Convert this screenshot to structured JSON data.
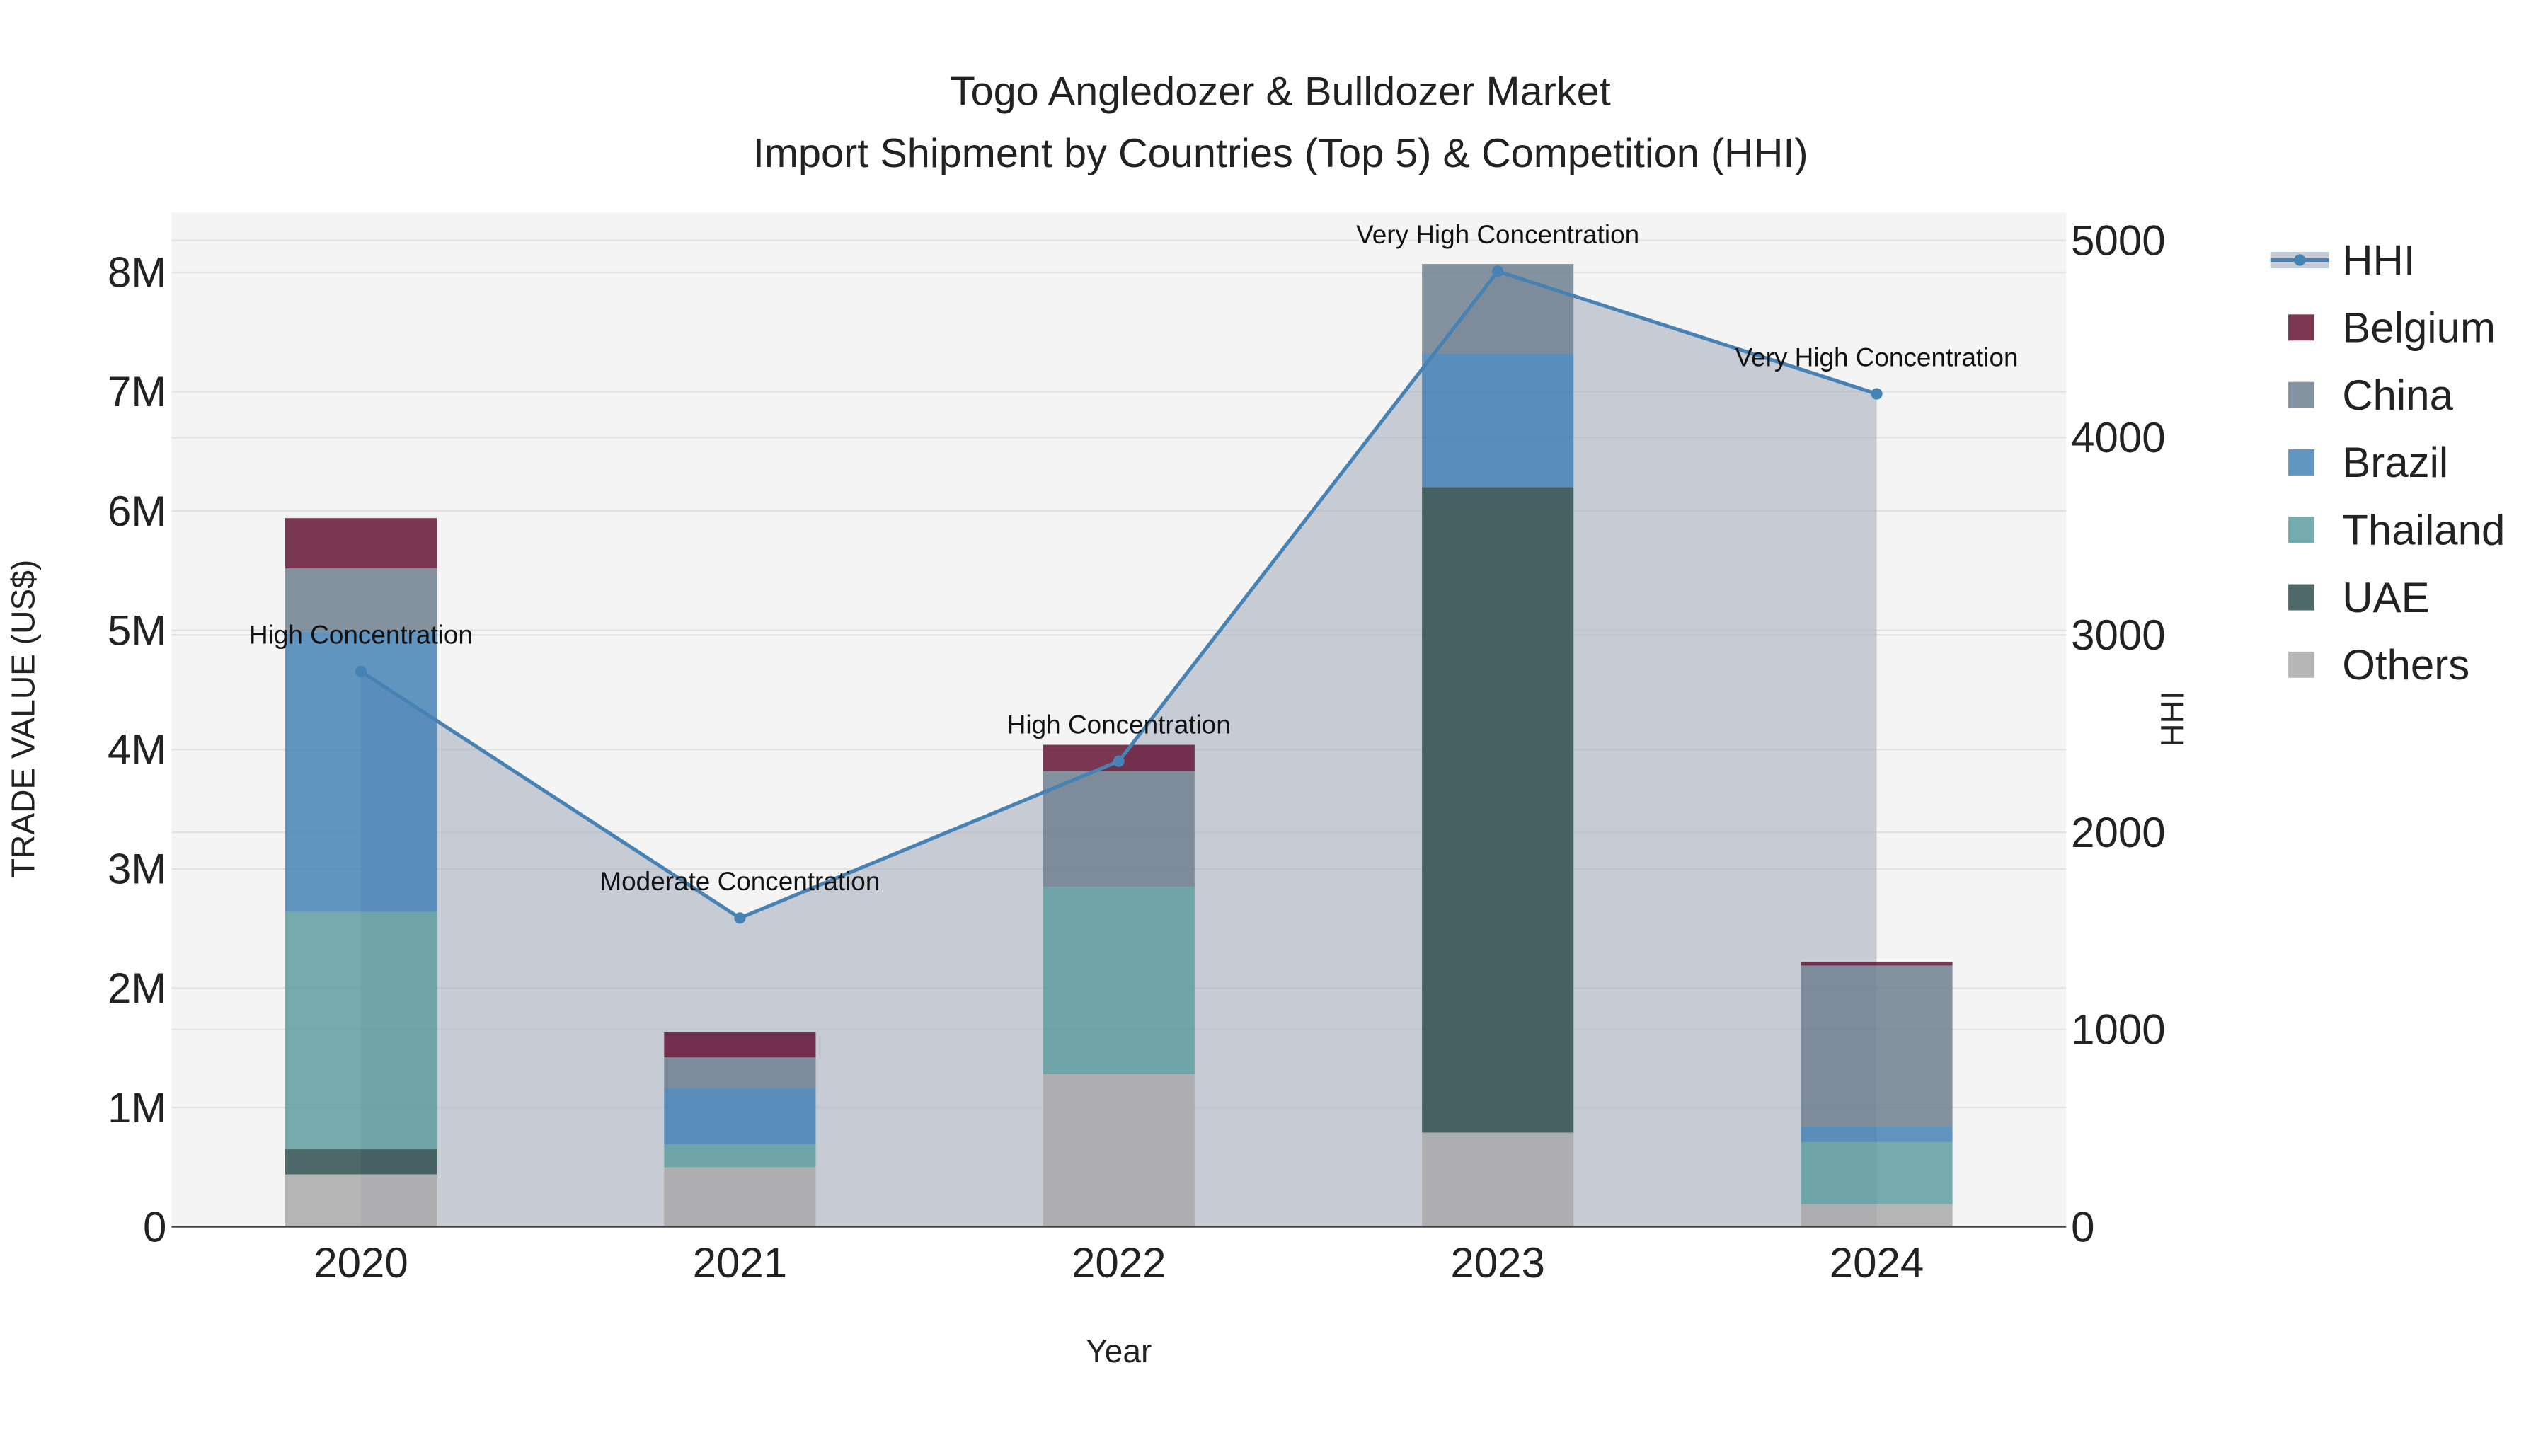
{
  "chart_data": {
    "type": "bar",
    "title_line1": "Togo Angledozer & Bulldozer Market",
    "title_line2": "Import Shipment by Countries (Top 5) & Competition (HHI)",
    "xlabel": "Year",
    "ylabel": "TRADE VALUE (US$)",
    "y2label": "HHI",
    "categories": [
      "2020",
      "2021",
      "2022",
      "2023",
      "2024"
    ],
    "ylim": [
      0,
      8500000
    ],
    "y2lim": [
      0,
      5140
    ],
    "yticks": [
      0,
      1000000,
      2000000,
      3000000,
      4000000,
      5000000,
      6000000,
      7000000,
      8000000
    ],
    "ytick_labels": [
      "0",
      "1M",
      "2M",
      "3M",
      "4M",
      "5M",
      "6M",
      "7M",
      "8M"
    ],
    "y2ticks": [
      0,
      1000,
      2000,
      3000,
      4000,
      5000
    ],
    "y2tick_labels": [
      "0",
      "1000",
      "2000",
      "3000",
      "4000",
      "5000"
    ],
    "grid": true,
    "legend_position": "right",
    "series": [
      {
        "name": "Others",
        "color": "#A9A9A9",
        "values": [
          440000,
          500000,
          1280000,
          790000,
          190000
        ]
      },
      {
        "name": "UAE",
        "color": "#2F4F4F",
        "values": [
          210000,
          0,
          0,
          5410000,
          0
        ]
      },
      {
        "name": "Thailand",
        "color": "#5F9EA0",
        "values": [
          1990000,
          190000,
          1570000,
          0,
          520000
        ]
      },
      {
        "name": "Brazil",
        "color": "#4682B4",
        "values": [
          2350000,
          470000,
          0,
          1120000,
          130000
        ]
      },
      {
        "name": "China",
        "color": "#708090",
        "values": [
          530000,
          260000,
          970000,
          750000,
          1350000
        ]
      },
      {
        "name": "Belgium",
        "color": "#631535",
        "values": [
          420000,
          210000,
          220000,
          0,
          30000
        ]
      }
    ],
    "hhi": {
      "name": "HHI",
      "color": "#4682B4",
      "values": [
        2815,
        1565,
        2360,
        4843,
        4222
      ],
      "annotations": [
        "High Concentration",
        "Moderate Concentration",
        "High Concentration",
        "Very High Concentration",
        "Very High Concentration"
      ]
    },
    "legend_order": [
      "HHI",
      "Belgium",
      "China",
      "Brazil",
      "Thailand",
      "UAE",
      "Others"
    ]
  }
}
